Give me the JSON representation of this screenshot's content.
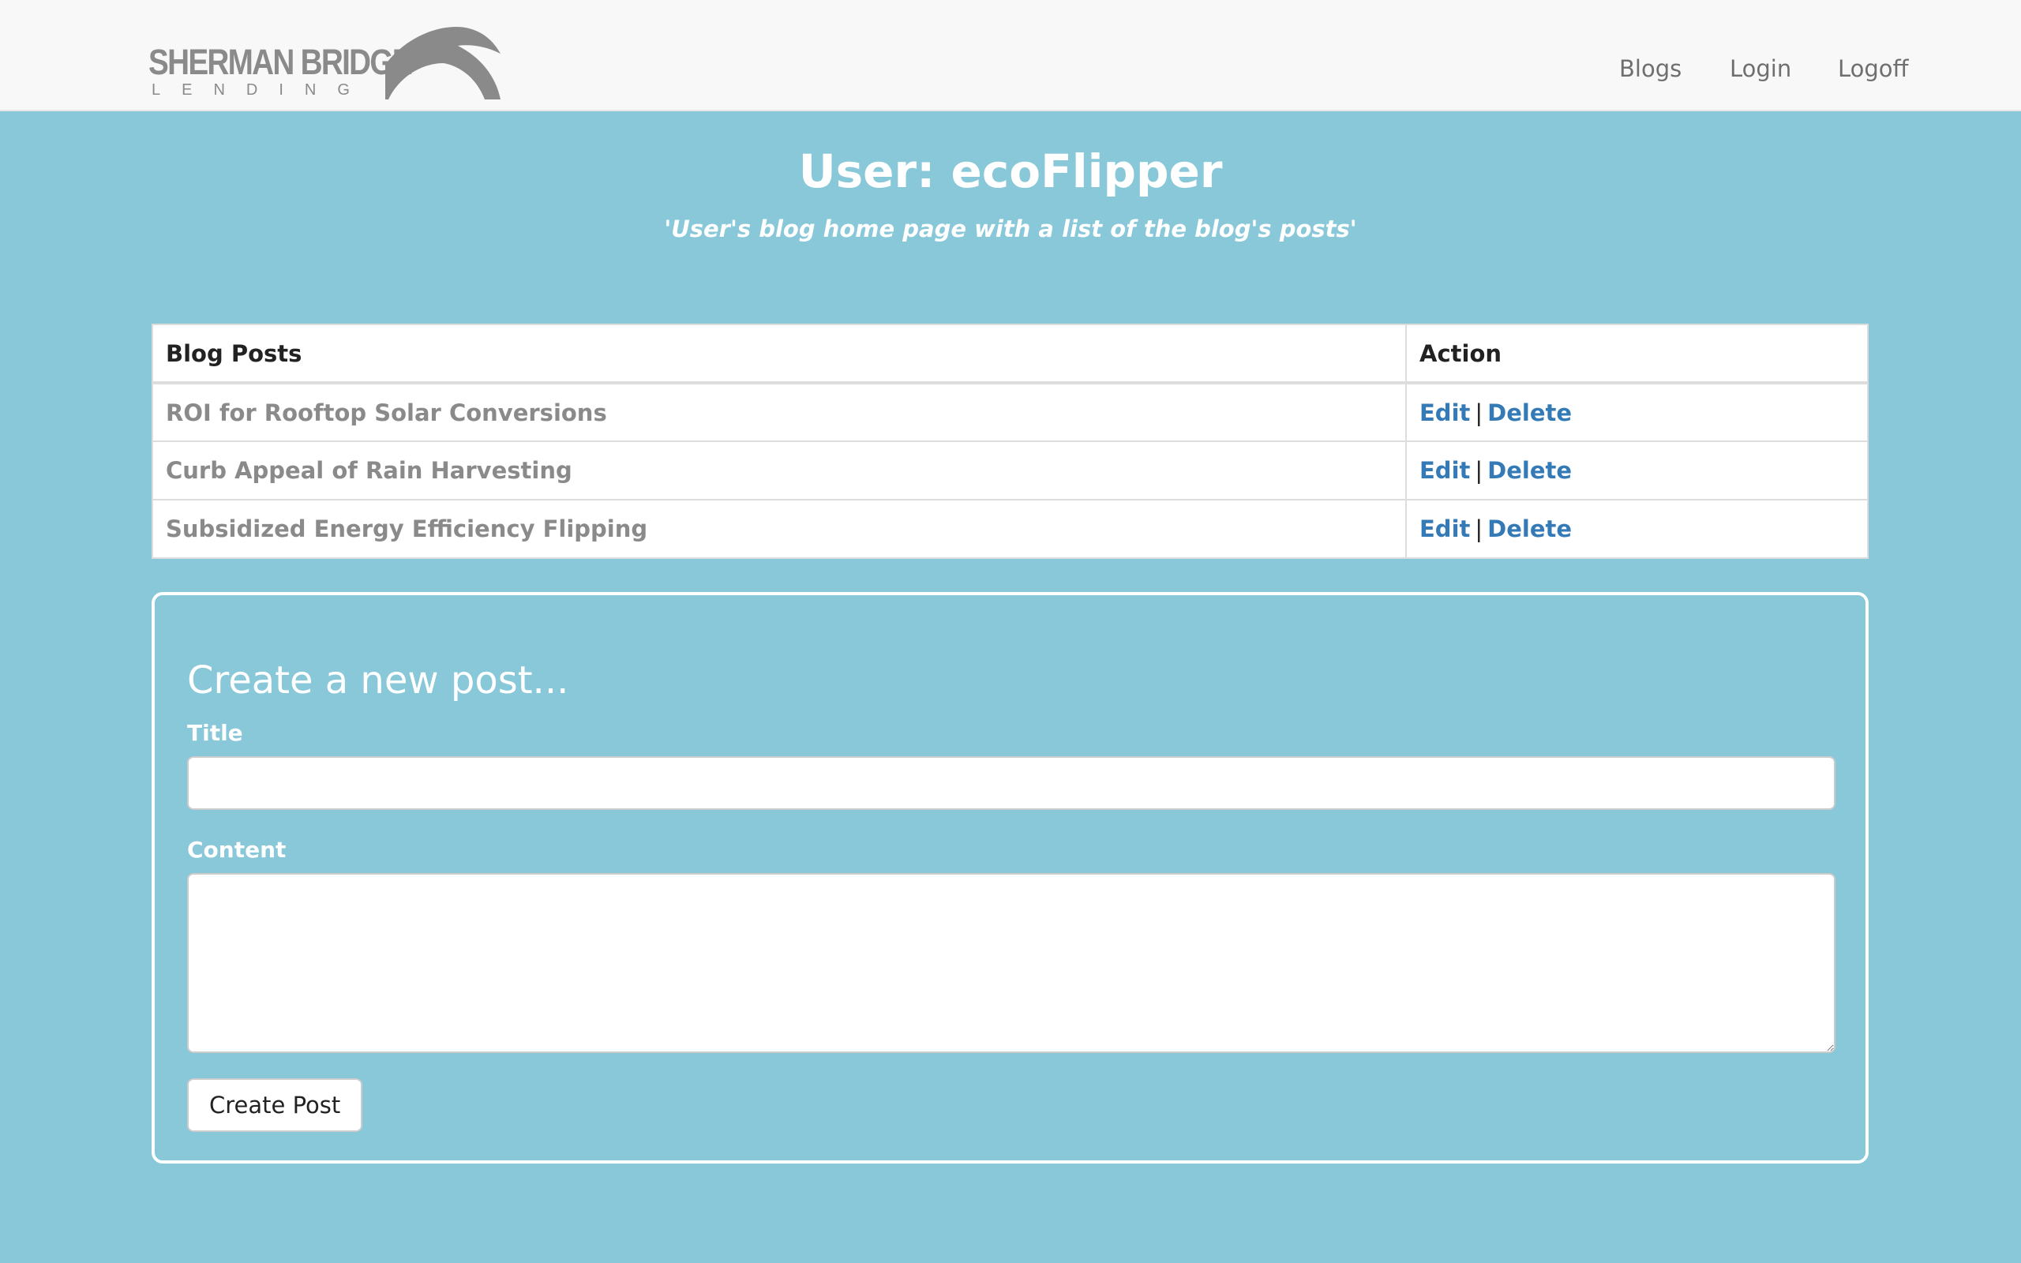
{
  "brand": {
    "name_line1": "SHERMAN BRIDGE",
    "name_line2": "LENDING"
  },
  "nav": {
    "items": [
      {
        "label": "Blogs"
      },
      {
        "label": "Login"
      },
      {
        "label": "Logoff"
      }
    ]
  },
  "header": {
    "title": "User: ecoFlipper",
    "subtitle": "'User's blog home page with a list of the blog's posts'"
  },
  "posts_table": {
    "headers": [
      "Blog Posts",
      "Action"
    ],
    "rows": [
      {
        "title": "ROI for Rooftop Solar Conversions",
        "edit": "Edit",
        "separator": "|",
        "delete": "Delete"
      },
      {
        "title": "Curb Appeal of Rain Harvesting",
        "edit": "Edit",
        "separator": "|",
        "delete": "Delete"
      },
      {
        "title": "Subsidized Energy Efficiency Flipping",
        "edit": "Edit",
        "separator": "|",
        "delete": "Delete"
      }
    ]
  },
  "create_form": {
    "heading": "Create a new post...",
    "title_label": "Title",
    "title_value": "",
    "content_label": "Content",
    "content_value": "",
    "submit_label": "Create Post"
  },
  "colors": {
    "background": "#88c8d9",
    "navbar": "#f8f8f8",
    "link": "#337ab7",
    "logo_gray": "#8a8a8a"
  }
}
